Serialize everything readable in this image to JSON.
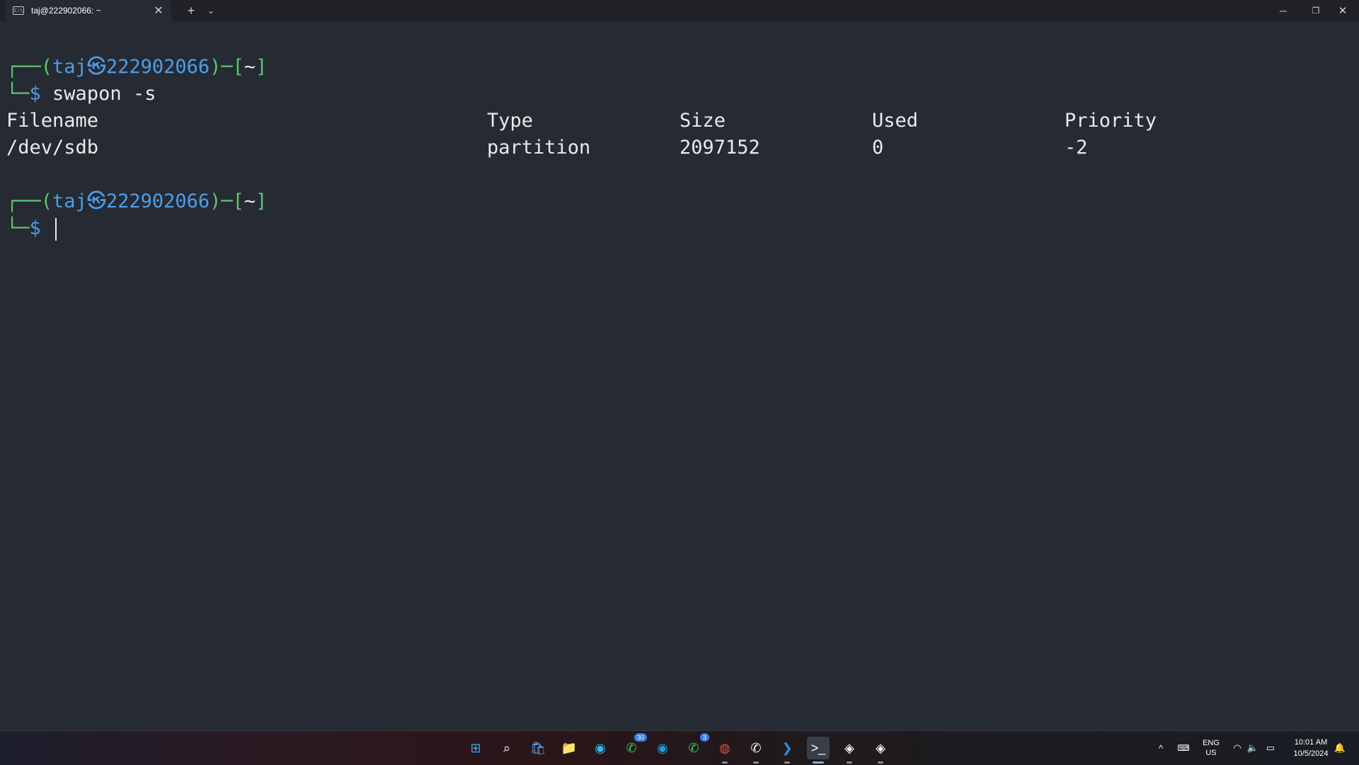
{
  "window": {
    "tab_title": "taj@222902066: ~",
    "tab_icon_text": "C:\\",
    "new_tab": "+",
    "dropdown": "⌄",
    "close_tab": "✕",
    "minimize": "─",
    "maximize": "❐",
    "close": "✕"
  },
  "terminal": {
    "prompt1": {
      "corner_top": "┌──(",
      "user": "taj",
      "at": "㉿",
      "host": "222902066",
      "mid": ")─[",
      "dir": "~",
      "end": "]",
      "corner_bottom": "└─",
      "dollar": "$",
      "command": "swapon -s"
    },
    "table": {
      "headers": [
        "Filename",
        "Type",
        "Size",
        "Used",
        "Priority"
      ],
      "row": [
        "/dev/sdb",
        "partition",
        "2097152",
        "0",
        "-2"
      ]
    },
    "prompt2": {
      "corner_top": "┌──(",
      "user": "taj",
      "at": "㉿",
      "host": "222902066",
      "mid": ")─[",
      "dir": "~",
      "end": "]",
      "corner_bottom": "└─",
      "dollar": "$",
      "command": ""
    }
  },
  "taskbar": {
    "icons": [
      {
        "name": "windows-start-icon",
        "glyph": "⊞",
        "color": "#3aa0f0"
      },
      {
        "name": "search-icon",
        "glyph": "⌕",
        "color": "#ffffff"
      },
      {
        "name": "microsoft-store-icon",
        "glyph": "🛍",
        "color": "#5ab0ff"
      },
      {
        "name": "file-explorer-icon",
        "glyph": "📁",
        "color": "#f5c542"
      },
      {
        "name": "edge-icon",
        "glyph": "◉",
        "color": "#2fb6e8"
      },
      {
        "name": "whatsapp-icon",
        "glyph": "✆",
        "color": "#2fd15f",
        "badge": "30"
      },
      {
        "name": "edge-dev-icon",
        "glyph": "◉",
        "color": "#1f9adf"
      },
      {
        "name": "whatsapp-business-icon",
        "glyph": "✆",
        "color": "#2fd15f",
        "badge": "3"
      },
      {
        "name": "chrome-icon",
        "glyph": "◍",
        "color": "#e84a3a"
      },
      {
        "name": "whatsapp-web-icon",
        "glyph": "✆",
        "color": "#ffffff"
      },
      {
        "name": "vscode-icon",
        "glyph": "❯",
        "color": "#2a8fe6"
      },
      {
        "name": "terminal-icon",
        "glyph": ">_",
        "color": "#ffffff",
        "active": true
      },
      {
        "name": "vpn-client-icon",
        "glyph": "◈",
        "color": "#ffffff"
      },
      {
        "name": "vpn-client-2-icon",
        "glyph": "◈",
        "color": "#ffffff"
      }
    ],
    "tray": {
      "up_arrow": "^",
      "keyboard": "⌨",
      "lang_top": "ENG",
      "lang_bottom": "US",
      "wifi": "◠",
      "volume": "🔈",
      "battery": "▭",
      "time": "10:01 AM",
      "date": "10/5/2024",
      "notification": "🔔"
    }
  }
}
